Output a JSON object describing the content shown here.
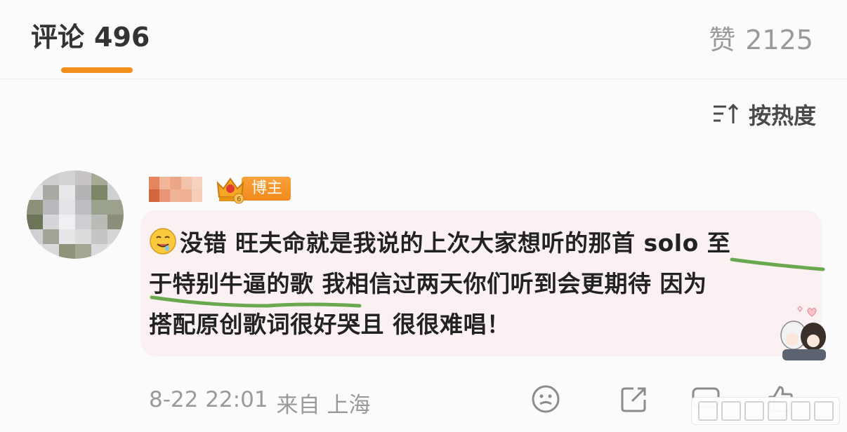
{
  "header": {
    "comments_label": "评论",
    "comments_count": "496",
    "likes_label": "赞",
    "likes_count": "2125",
    "accent_color": "#f0901a"
  },
  "sort": {
    "icon": "sort-lines-arrow-icon",
    "label": "按热度"
  },
  "comment": {
    "badge_icon": "crown-level-6-icon",
    "badge_label": "博主",
    "emoji": "drooling-face-emoji",
    "text": "没错 旺夫命就是我说的上次大家想听的那首 solo 至\n于特别牛逼的歌 我相信过两天你们听到会更期待 因为\n搭配原创歌词很好哭且 很很难唱！",
    "sticker": "anime-couple-sticker",
    "time": "8-22 22:01",
    "source": "来自 上海",
    "highlight_color": "#6aa84f",
    "bubble_color": "#fbf1f2"
  },
  "actions": [
    {
      "name": "reaction-button",
      "icon": "smiley-face-icon"
    },
    {
      "name": "share-button",
      "icon": "share-box-icon"
    },
    {
      "name": "reply-button",
      "icon": "comment-box-icon"
    },
    {
      "name": "like-button",
      "icon": "thumbs-up-icon"
    }
  ]
}
